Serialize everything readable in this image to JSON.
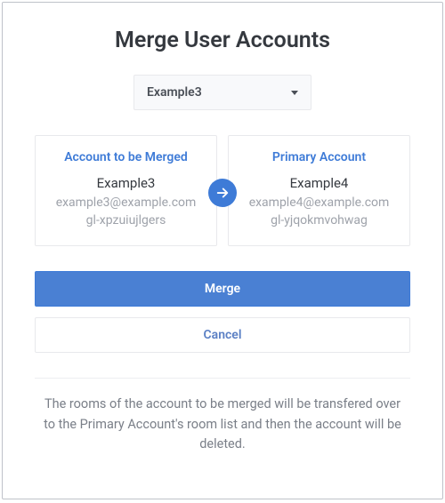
{
  "title": "Merge User Accounts",
  "dropdown": {
    "selected": "Example3"
  },
  "merge_account": {
    "heading": "Account to be Merged",
    "name": "Example3",
    "email": "example3@example.com",
    "id": "gl-xpzuiujlgers"
  },
  "primary_account": {
    "heading": "Primary Account",
    "name": "Example4",
    "email": "example4@example.com",
    "id": "gl-yjqokmvohwag"
  },
  "buttons": {
    "merge": "Merge",
    "cancel": "Cancel"
  },
  "info": "The rooms of the account to be merged will be transfered over to the Primary Account's room list and then the account will be deleted."
}
